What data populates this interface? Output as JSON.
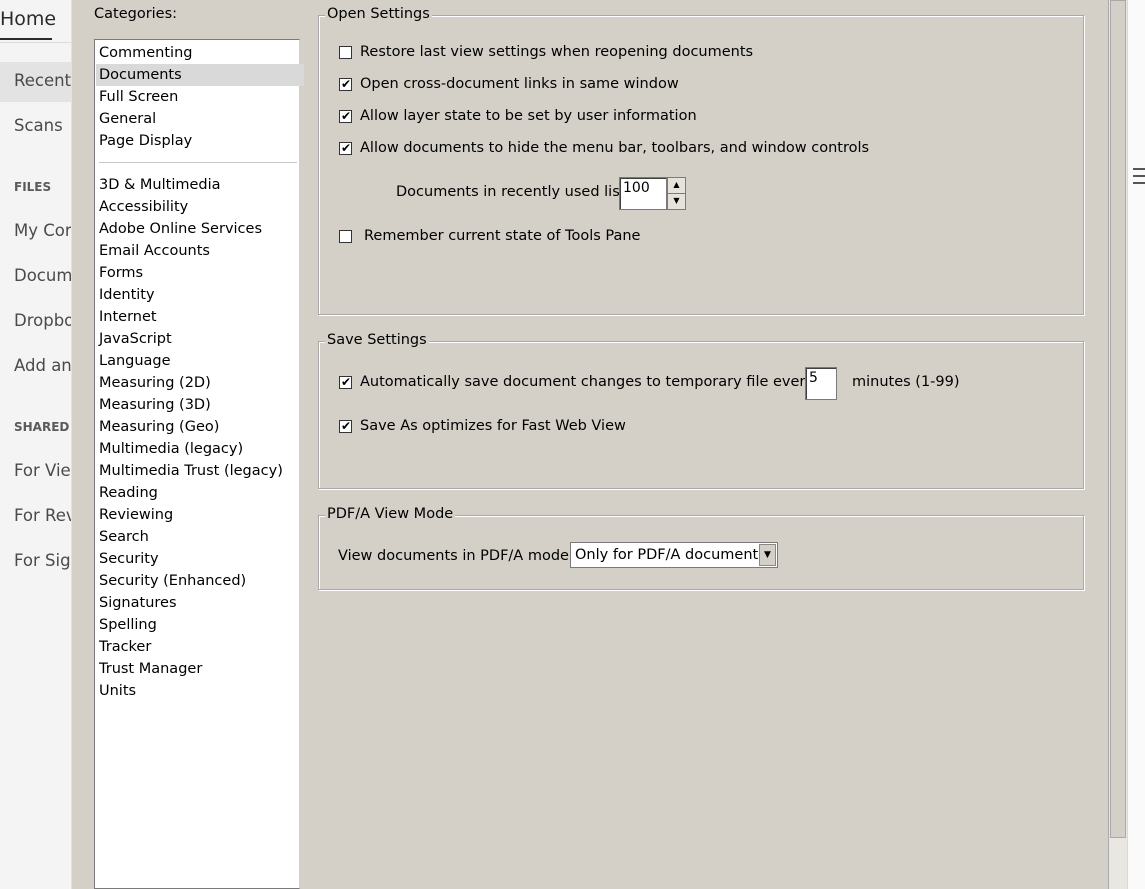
{
  "left_panel": {
    "home_tab": "Home",
    "items": [
      {
        "label": "Recent",
        "selected": true
      },
      {
        "label": "Scans"
      }
    ],
    "files_section": "FILES",
    "file_items": [
      "My Cor",
      "Docum",
      "Dropbo",
      "Add an"
    ],
    "shared_section": "SHARED",
    "shared_items": [
      "For View",
      "For Rev",
      "For Sign"
    ]
  },
  "categories": {
    "label": "Categories:",
    "group1": [
      "Commenting",
      "Documents",
      "Full Screen",
      "General",
      "Page Display"
    ],
    "selected": "Documents",
    "group2": [
      "3D & Multimedia",
      "Accessibility",
      "Adobe Online Services",
      "Email Accounts",
      "Forms",
      "Identity",
      "Internet",
      "JavaScript",
      "Language",
      "Measuring (2D)",
      "Measuring (3D)",
      "Measuring (Geo)",
      "Multimedia (legacy)",
      "Multimedia Trust (legacy)",
      "Reading",
      "Reviewing",
      "Search",
      "Security",
      "Security (Enhanced)",
      "Signatures",
      "Spelling",
      "Tracker",
      "Trust Manager",
      "Units"
    ]
  },
  "open_settings": {
    "title": "Open Settings",
    "restore_view": {
      "label": "Restore last view settings when reopening documents",
      "checked": false
    },
    "cross_doc": {
      "label": "Open cross-document links in same window",
      "checked": true
    },
    "layer_state": {
      "label": "Allow layer state to be set by user information",
      "checked": true
    },
    "hide_menu": {
      "label": "Allow documents to hide the menu bar, toolbars, and window controls",
      "checked": true
    },
    "recent_list_label": "Documents in recently used list:",
    "recent_list_value": "100",
    "tools_pane": {
      "label": "Remember current state of Tools Pane",
      "checked": false
    }
  },
  "save_settings": {
    "title": "Save Settings",
    "autosave": {
      "label": "Automatically save document changes to temporary file every:",
      "checked": true
    },
    "autosave_minutes": "5",
    "minutes_label": "minutes (1-99)",
    "fast_web": {
      "label": "Save As optimizes for Fast Web View",
      "checked": true
    }
  },
  "pdfa": {
    "title": "PDF/A View Mode",
    "label": "View documents in PDF/A mode:",
    "value": "Only for PDF/A documents"
  }
}
